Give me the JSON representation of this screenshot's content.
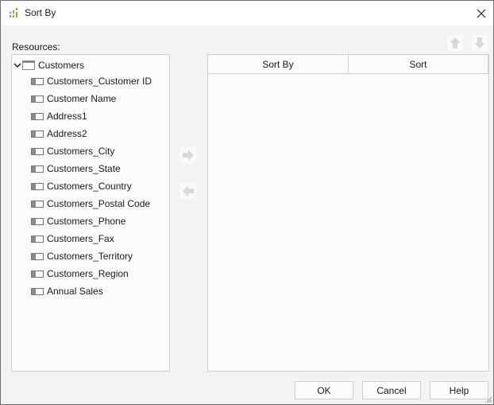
{
  "window": {
    "title": "Sort By",
    "close_icon": "close-icon",
    "app_icon": "sort-by-icon"
  },
  "resources": {
    "label": "Resources:",
    "root": {
      "label": "Customers",
      "expanded": true,
      "icon": "table-icon"
    },
    "fields": [
      {
        "label": "Customers_Customer ID"
      },
      {
        "label": "Customer Name"
      },
      {
        "label": "Address1"
      },
      {
        "label": "Address2"
      },
      {
        "label": "Customers_City"
      },
      {
        "label": "Customers_State"
      },
      {
        "label": "Customers_Country"
      },
      {
        "label": "Customers_Postal Code"
      },
      {
        "label": "Customers_Phone"
      },
      {
        "label": "Customers_Fax"
      },
      {
        "label": "Customers_Territory"
      },
      {
        "label": "Customers_Region"
      },
      {
        "label": "Annual Sales"
      }
    ]
  },
  "transfer": {
    "add_icon": "arrow-right-icon",
    "remove_icon": "arrow-left-icon"
  },
  "ordering": {
    "move_up_icon": "arrow-up-icon",
    "move_down_icon": "arrow-down-icon"
  },
  "sort_grid": {
    "columns": [
      "Sort By",
      "Sort"
    ],
    "rows": []
  },
  "buttons": {
    "ok": "OK",
    "cancel": "Cancel",
    "help": "Help"
  },
  "colors": {
    "accent_icon": "#7cb342",
    "disabled_arrow": "#d8d8d8"
  }
}
